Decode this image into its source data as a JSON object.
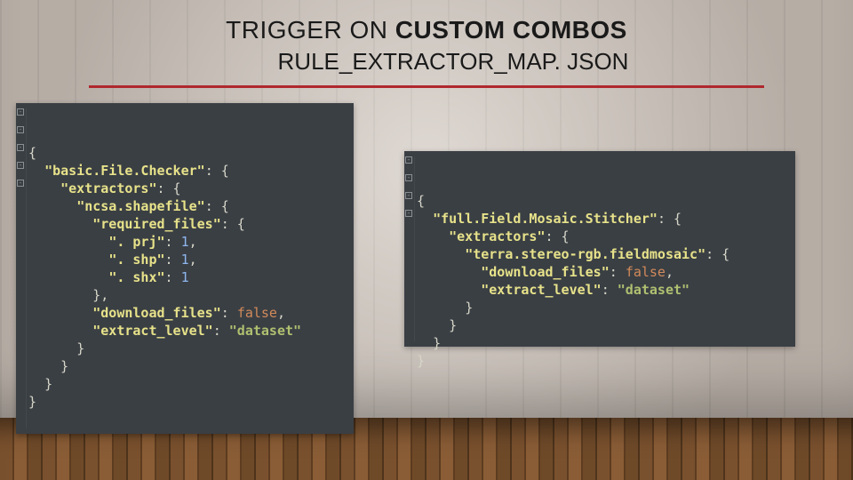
{
  "title": {
    "line1_prefix": "TRIGGER ON ",
    "line1_bold": "CUSTOM COMBOS",
    "line2": "RULE_EXTRACTOR_MAP. JSON"
  },
  "code_left": {
    "json": {
      "basic.File.Checker": {
        "extractors": {
          "ncsa.shapefile": {
            "required_files": {
              ". prj": 1,
              ". shp": 1,
              ". shx": 1
            },
            "download_files": false,
            "extract_level": "dataset"
          }
        }
      }
    }
  },
  "code_right": {
    "json": {
      "full.Field.Mosaic.Stitcher": {
        "extractors": {
          "terra.stereo-rgb.fieldmosaic": {
            "download_files": false,
            "extract_level": "dataset"
          }
        }
      }
    }
  },
  "left_tokens": {
    "l0": "{",
    "l1_k": "\"basic.File.Checker\"",
    "l2_k": "\"extractors\"",
    "l3_k": "\"ncsa.shapefile\"",
    "l4_k": "\"required_files\"",
    "l5_k": "\". prj\"",
    "l5_v": "1",
    "l6_k": "\". shp\"",
    "l6_v": "1",
    "l7_k": "\". shx\"",
    "l7_v": "1",
    "l9_k": "\"download_files\"",
    "l9_v": "false",
    "l10_k": "\"extract_level\"",
    "l10_v": "\"dataset\"",
    "brace_open": ": {",
    "brace_close": "}",
    "brace_close_c": "},",
    "comma": ","
  },
  "right_tokens": {
    "r1_k": "\"full.Field.Mosaic.Stitcher\"",
    "r2_k": "\"extractors\"",
    "r3_k": "\"terra.stereo-rgb.fieldmosaic\"",
    "r4_k": "\"download_files\"",
    "r4_v": "false",
    "r5_k": "\"extract_level\"",
    "r5_v": "\"dataset\""
  }
}
